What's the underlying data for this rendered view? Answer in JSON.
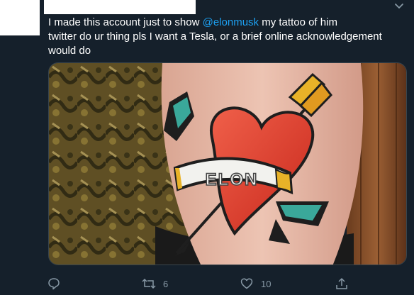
{
  "tweet": {
    "text_line1_pre": "I made this account just to show ",
    "mention": "@elonmusk",
    "text_line1_post": " my tattoo of him",
    "text_line2": "twitter do ur thing pls I want a Tesla, or a brief online acknowledgement",
    "text_line3": "would do"
  },
  "media": {
    "banner_text": "ELON"
  },
  "actions": {
    "reply_count": "",
    "retweet_count": "6",
    "like_count": "10"
  },
  "colors": {
    "background": "#15202b",
    "mention": "#1da1f2",
    "action_gray": "#8899a6"
  },
  "icons": [
    "chevron-down-icon",
    "reply-icon",
    "retweet-icon",
    "like-icon",
    "share-icon"
  ]
}
